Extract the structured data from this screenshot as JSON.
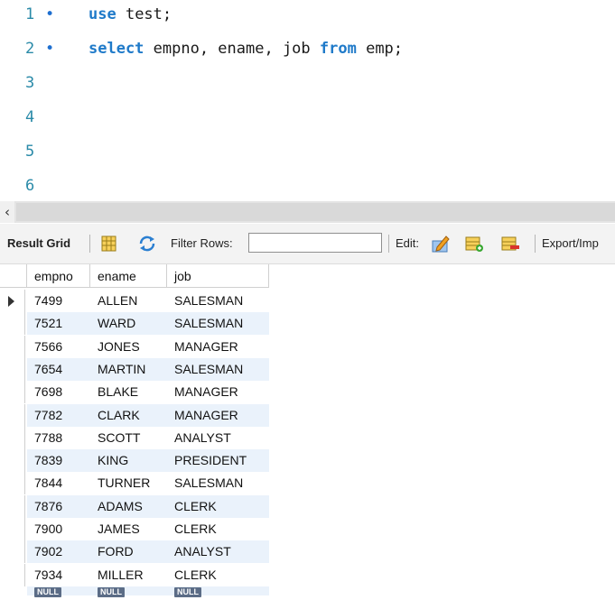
{
  "editor": {
    "lines": [
      {
        "num": "1",
        "bullet": "•",
        "parts": [
          {
            "kw": true,
            "text": "use"
          },
          {
            "kw": false,
            "text": " test;"
          }
        ]
      },
      {
        "num": "2",
        "bullet": "•",
        "parts": [
          {
            "kw": true,
            "text": "select"
          },
          {
            "kw": false,
            "text": " empno, ename, job "
          },
          {
            "kw": true,
            "text": "from"
          },
          {
            "kw": false,
            "text": " emp;"
          }
        ]
      },
      {
        "num": "3",
        "bullet": "",
        "parts": []
      },
      {
        "num": "4",
        "bullet": "",
        "parts": []
      },
      {
        "num": "5",
        "bullet": "",
        "parts": []
      },
      {
        "num": "6",
        "bullet": "",
        "parts": []
      }
    ]
  },
  "scrollbar": {
    "left_arrow": "‹"
  },
  "toolbar": {
    "result_grid": "Result Grid",
    "filter_rows": "Filter Rows:",
    "filter_value": "",
    "edit": "Edit:",
    "export": "Export/Imp"
  },
  "grid": {
    "columns": [
      "empno",
      "ename",
      "job"
    ],
    "rows": [
      [
        "7499",
        "ALLEN",
        "SALESMAN"
      ],
      [
        "7521",
        "WARD",
        "SALESMAN"
      ],
      [
        "7566",
        "JONES",
        "MANAGER"
      ],
      [
        "7654",
        "MARTIN",
        "SALESMAN"
      ],
      [
        "7698",
        "BLAKE",
        "MANAGER"
      ],
      [
        "7782",
        "CLARK",
        "MANAGER"
      ],
      [
        "7788",
        "SCOTT",
        "ANALYST"
      ],
      [
        "7839",
        "KING",
        "PRESIDENT"
      ],
      [
        "7844",
        "TURNER",
        "SALESMAN"
      ],
      [
        "7876",
        "ADAMS",
        "CLERK"
      ],
      [
        "7900",
        "JAMES",
        "CLERK"
      ],
      [
        "7902",
        "FORD",
        "ANALYST"
      ],
      [
        "7934",
        "MILLER",
        "CLERK"
      ]
    ],
    "null_label": "NULL"
  },
  "colors": {
    "keyword": "#1f7ac9",
    "line_number": "#2a8aa8",
    "row_alt": "#eaf2fb"
  }
}
